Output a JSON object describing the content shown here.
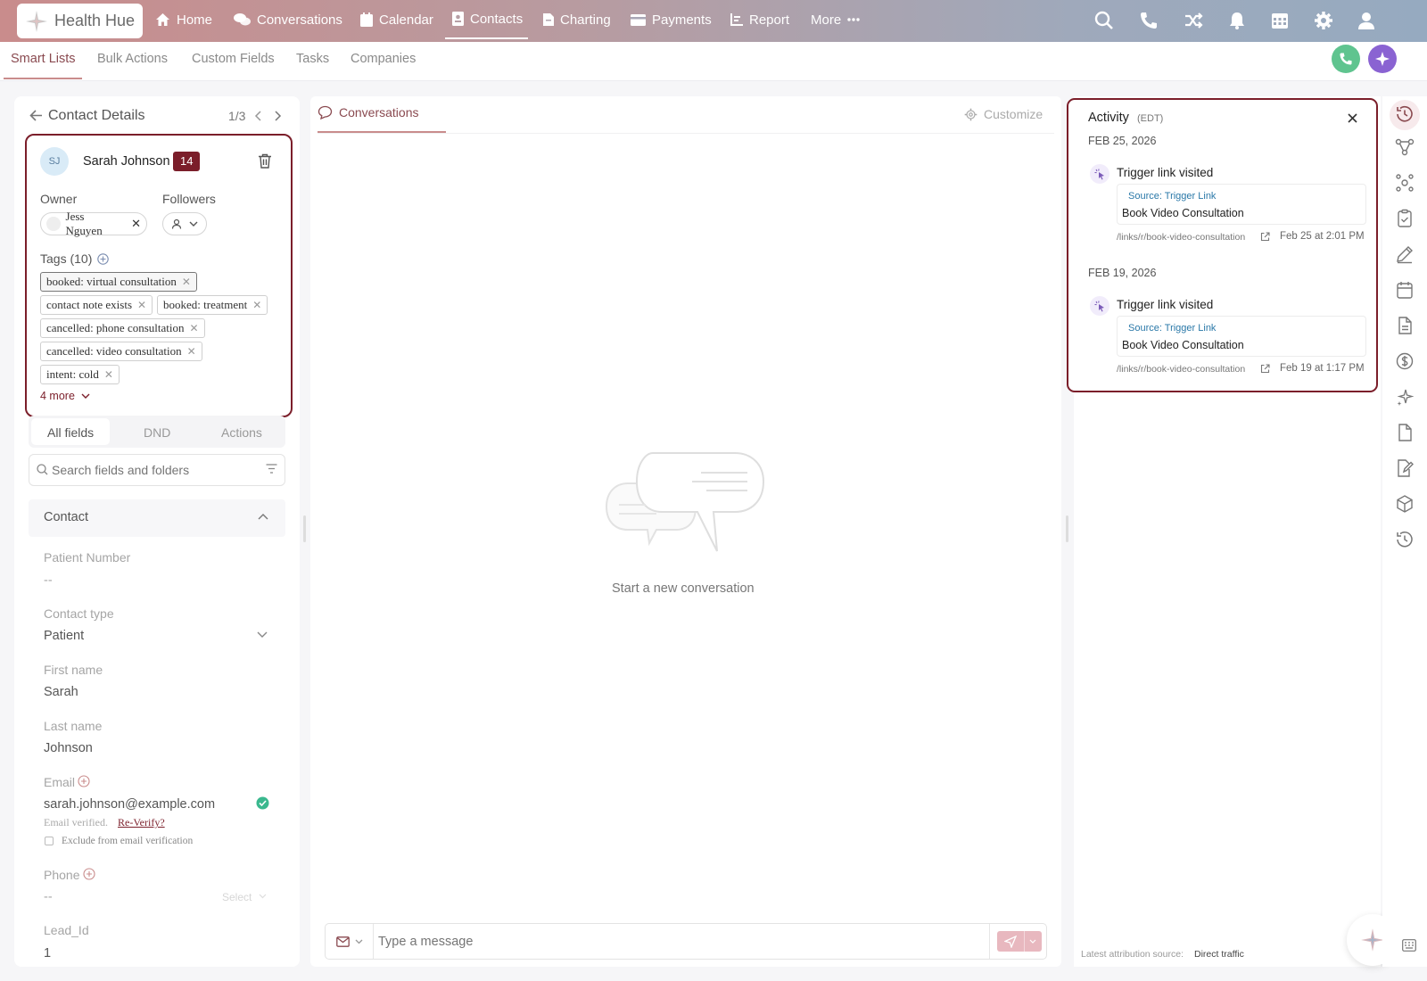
{
  "brand": {
    "name": "Health Hue"
  },
  "nav": {
    "items": [
      {
        "label": "Home",
        "icon": "home-icon"
      },
      {
        "label": "Conversations",
        "icon": "chat-icon"
      },
      {
        "label": "Calendar",
        "icon": "calendar-icon"
      },
      {
        "label": "Contacts",
        "icon": "contacts-icon"
      },
      {
        "label": "Charting",
        "icon": "document-icon"
      },
      {
        "label": "Payments",
        "icon": "card-icon"
      },
      {
        "label": "Report",
        "icon": "report-icon"
      },
      {
        "label": "More",
        "icon": "ellipsis-icon"
      }
    ],
    "active": "Contacts"
  },
  "subnav": {
    "items": [
      "Smart Lists",
      "Bulk Actions",
      "Custom Fields",
      "Tasks",
      "Companies"
    ],
    "active": "Smart Lists"
  },
  "contact_panel": {
    "title": "Contact Details",
    "pager": "1/3",
    "initials": "SJ",
    "name": "Sarah Johnson",
    "badge": "14",
    "owner_label": "Owner",
    "owner_value": "Jess Nguyen",
    "followers_label": "Followers",
    "tags_label": "Tags (10)",
    "tags": [
      "booked: virtual consultation",
      "contact note exists",
      "booked: treatment",
      "cancelled: phone consultation",
      "cancelled: video consultation",
      "intent: cold"
    ],
    "more_tags": "4 more",
    "tabs": [
      "All fields",
      "DND",
      "Actions"
    ],
    "search_placeholder": "Search fields and folders",
    "section": "Contact",
    "fields": {
      "patient_number_label": "Patient Number",
      "patient_number_value": "--",
      "contact_type_label": "Contact type",
      "contact_type_value": "Patient",
      "first_name_label": "First name",
      "first_name_value": "Sarah",
      "last_name_label": "Last name",
      "last_name_value": "Johnson",
      "email_label": "Email",
      "email_value": "sarah.johnson@example.com",
      "email_verified": "Email verified.",
      "reverify": "Re-Verify?",
      "exclude_label": "Exclude from email verification",
      "phone_label": "Phone",
      "phone_value": "--",
      "phone_select": "Select",
      "lead_id_label": "Lead_Id",
      "lead_id_value": "1"
    }
  },
  "conversation": {
    "tab": "Conversations",
    "customize": "Customize",
    "empty_text": "Start a new conversation",
    "composer_placeholder": "Type a message"
  },
  "activity": {
    "title": "Activity",
    "tz": "(EDT)",
    "groups": [
      {
        "date": "FEB 25, 2026",
        "event": "Trigger link visited",
        "source": "Source: Trigger Link",
        "name": "Book Video Consultation",
        "link": "/links/r/book-video-consultation",
        "time": "Feb 25 at 2:01 PM"
      },
      {
        "date": "FEB 19, 2026",
        "event": "Trigger link visited",
        "source": "Source: Trigger Link",
        "name": "Book Video Consultation",
        "link": "/links/r/book-video-consultation",
        "time": "Feb 19 at 1:17 PM"
      }
    ],
    "attribution_label": "Latest attribution source:",
    "attribution_value": "Direct traffic"
  },
  "colors": {
    "accent": "#7b1e2a",
    "link": "#2a78a8",
    "verified": "#3ab88e",
    "call": "#5fc48f",
    "ai": "#8a63d2"
  }
}
